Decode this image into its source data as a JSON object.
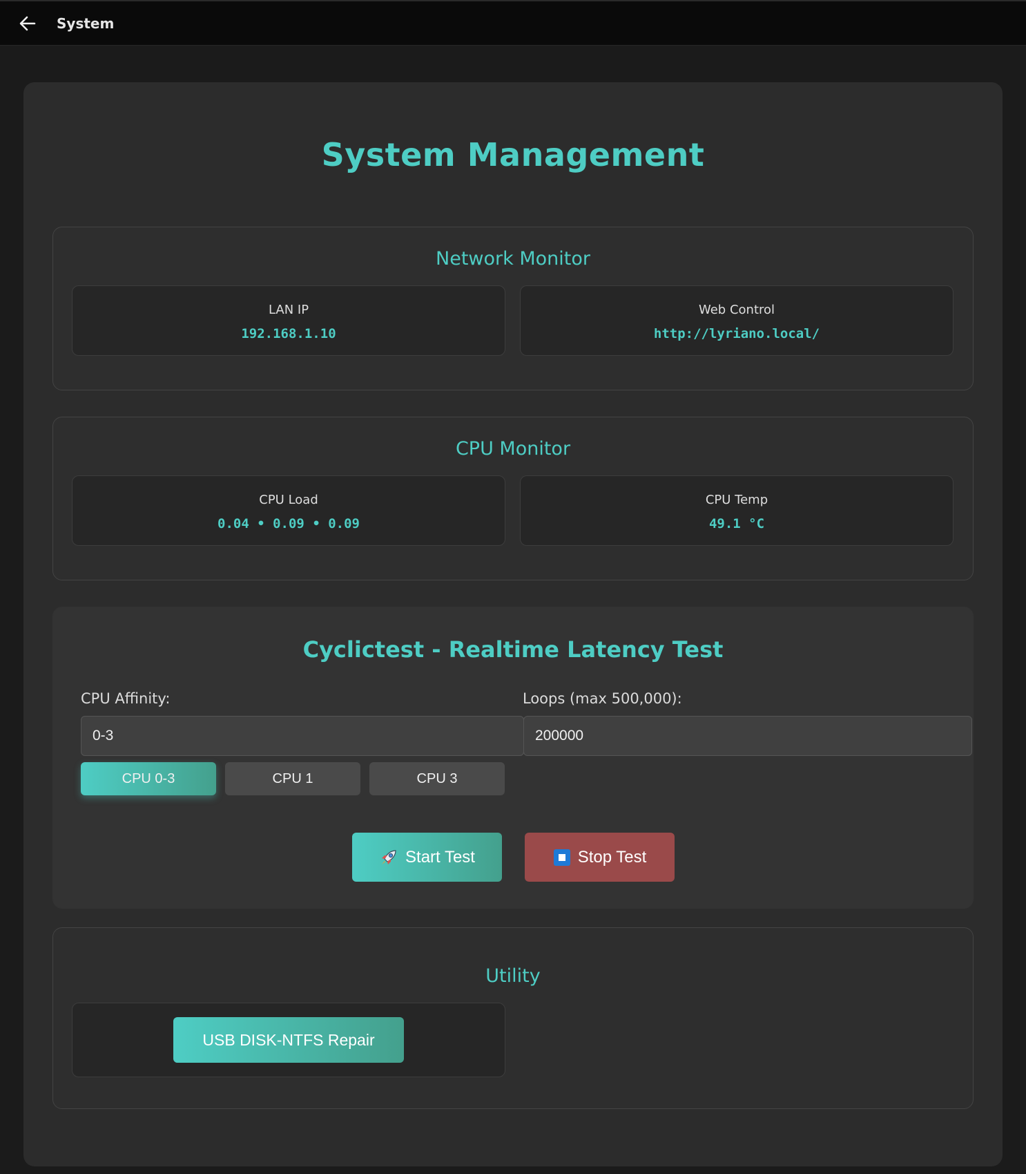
{
  "topbar": {
    "title": "System"
  },
  "page": {
    "title": "System Management"
  },
  "network": {
    "title": "Network Monitor",
    "lan_ip": {
      "label": "LAN IP",
      "value": "192.168.1.10"
    },
    "web_control": {
      "label": "Web Control",
      "value": "http://lyriano.local/"
    }
  },
  "cpu": {
    "title": "CPU Monitor",
    "load": {
      "label": "CPU Load",
      "value": "0.04 • 0.09 • 0.09"
    },
    "temp": {
      "label": "CPU Temp",
      "value": "49.1 °C"
    }
  },
  "cyclictest": {
    "title": "Cyclictest - Realtime Latency Test",
    "affinity_label": "CPU Affinity:",
    "affinity_value": "0-3",
    "loops_label": "Loops (max 500,000):",
    "loops_value": "200000",
    "presets": [
      "CPU 0-3",
      "CPU 1",
      "CPU 3"
    ],
    "selected_preset": "CPU 0-3",
    "start_label": "Start Test",
    "stop_label": "Stop Test"
  },
  "utility": {
    "title": "Utility",
    "repair_label": "USB DISK-NTFS Repair"
  },
  "colors": {
    "accent": "#4ecdc4",
    "accent_end": "#44a08d",
    "stop": "#9a4a4a"
  },
  "icons": {
    "back": "arrow-left-icon",
    "start": "rocket-icon",
    "stop": "stop-square-icon"
  }
}
